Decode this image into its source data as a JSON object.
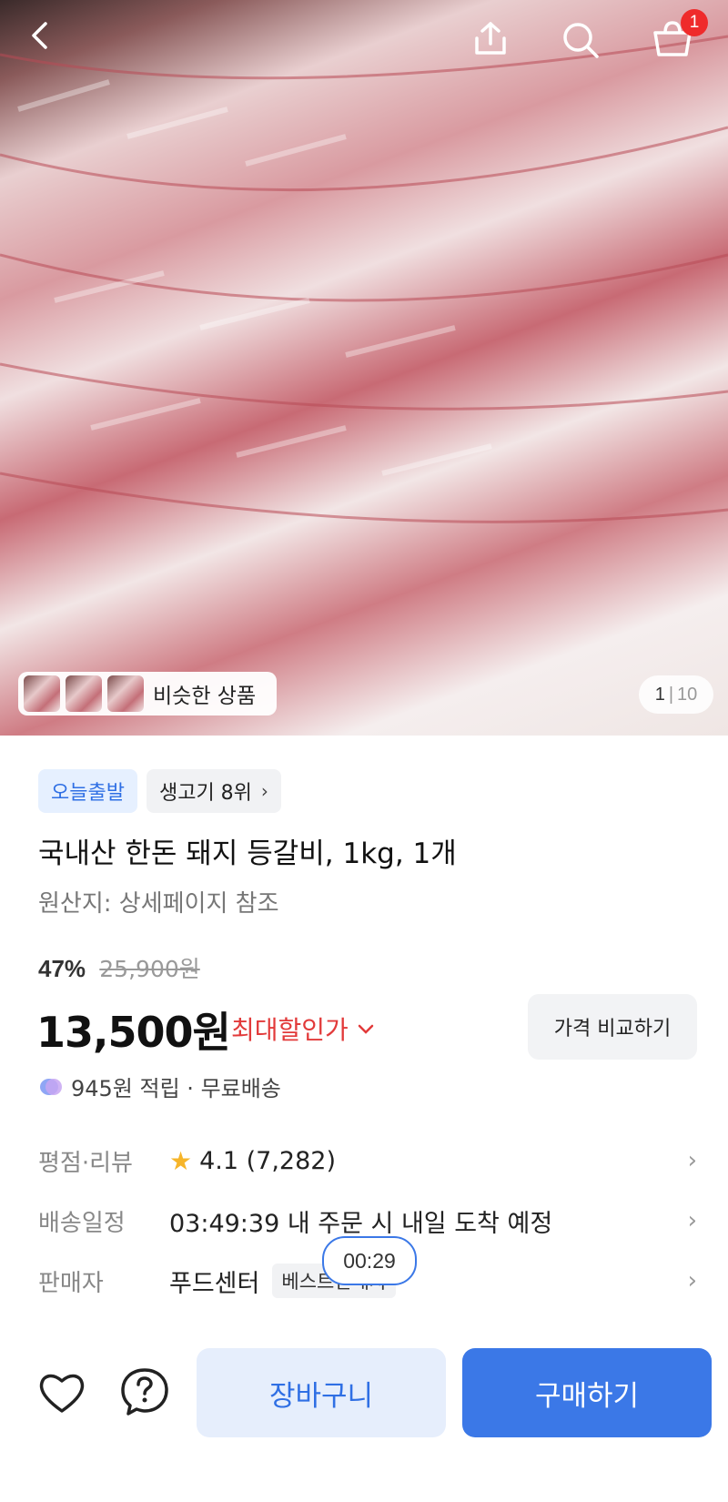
{
  "header": {
    "back_icon": "chevron-left-icon",
    "share_icon": "share-icon",
    "search_icon": "search-icon",
    "cart_icon": "cart-icon",
    "cart_count": "1"
  },
  "gallery": {
    "similar_label": "비슷한 상품",
    "current": "1",
    "separator": "|",
    "total": "10"
  },
  "tags": {
    "delivery": "오늘출발",
    "ranking": "생고기 8위"
  },
  "product": {
    "title": "국내산 한돈 돼지 등갈비, 1kg, 1개",
    "origin": "원산지: 상세페이지 참조",
    "discount_pct": "47%",
    "original_price": "25,900원",
    "price": "13,500원",
    "max_discount_label": "최대할인가",
    "compare_button": "가격 비교하기",
    "rewards": "945원 적립 · 무료배송"
  },
  "info": {
    "rating_label": "평점·리뷰",
    "rating_value": "4.1 (7,282)",
    "delivery_label": "배송일정",
    "delivery_value": "03:49:39 내 주문 시 내일 도착 예정",
    "seller_label": "판매자",
    "seller_value": "푸드센터",
    "seller_badge": "베스트판매자",
    "timer": "00:29"
  },
  "bottom": {
    "cart_button": "장바구니",
    "buy_button": "구매하기"
  },
  "colors": {
    "accent": "#3b78e7",
    "discount_red": "#e23a3a",
    "badge_red": "#ef2b2b"
  }
}
